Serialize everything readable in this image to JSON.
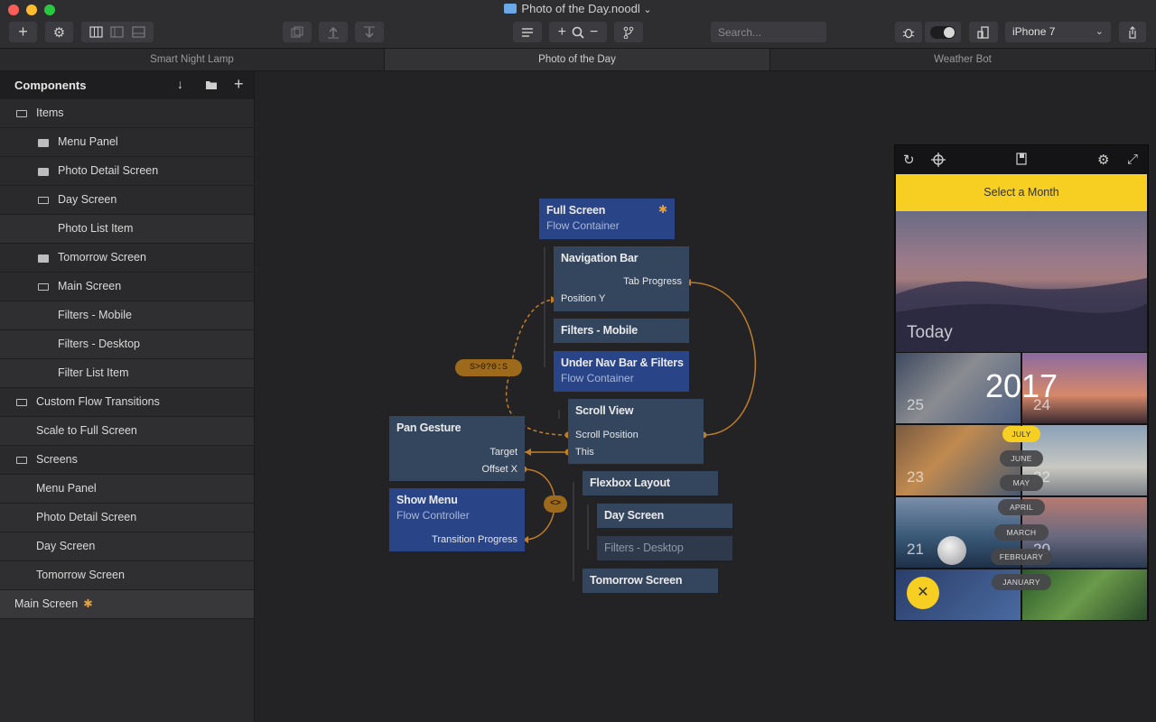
{
  "window": {
    "title": "Photo of the Day.noodl",
    "title_chevron": "⌄"
  },
  "toolbar": {
    "add_icon": "+",
    "settings_icon": "⚙",
    "search_placeholder": "Search...",
    "zoom_in": "+",
    "zoom_out": "−",
    "device": "iPhone 7",
    "device_chevron": "⌄"
  },
  "tabs": [
    {
      "label": "Smart Night Lamp"
    },
    {
      "label": "Photo of the Day"
    },
    {
      "label": "Weather Bot"
    }
  ],
  "sidebar": {
    "title": "Components",
    "items": [
      {
        "label": "Items"
      },
      {
        "label": "Menu Panel"
      },
      {
        "label": "Photo Detail Screen"
      },
      {
        "label": "Day Screen"
      },
      {
        "label": "Photo List Item"
      },
      {
        "label": "Tomorrow Screen"
      },
      {
        "label": "Main Screen"
      },
      {
        "label": "Filters - Mobile"
      },
      {
        "label": "Filters - Desktop"
      },
      {
        "label": "Filter List Item"
      },
      {
        "label": "Custom Flow Transitions"
      },
      {
        "label": "Scale to Full Screen"
      },
      {
        "label": "Screens"
      },
      {
        "label": "Menu Panel"
      },
      {
        "label": "Photo Detail Screen"
      },
      {
        "label": "Day Screen"
      },
      {
        "label": "Tomorrow Screen"
      },
      {
        "label": "Main Screen"
      }
    ],
    "selected_marker": "✱"
  },
  "nodes": {
    "full_screen": {
      "title": "Full Screen",
      "subtitle": "Flow Container",
      "marker": "✱"
    },
    "navigation_bar": {
      "title": "Navigation Bar",
      "port_tab_progress": "Tab Progress",
      "port_position_y": "Position Y"
    },
    "filters_mobile": {
      "title": "Filters - Mobile"
    },
    "under_nav": {
      "title": "Under Nav Bar & Filters",
      "subtitle": "Flow Container"
    },
    "scroll_view": {
      "title": "Scroll View",
      "port_scroll_position": "Scroll Position",
      "port_this": "This"
    },
    "pan_gesture": {
      "title": "Pan Gesture",
      "port_target": "Target",
      "port_offset_x": "Offset X"
    },
    "show_menu": {
      "title": "Show Menu",
      "subtitle": "Flow Controller",
      "port_transition_progress": "Transition Progress"
    },
    "flexbox_layout": {
      "title": "Flexbox Layout"
    },
    "day_screen": {
      "title": "Day Screen"
    },
    "filters_desktop": {
      "title": "Filters - Desktop"
    },
    "tomorrow_screen": {
      "title": "Tomorrow Screen"
    },
    "expression_label": "S>0?0:S",
    "switch_label": "<>"
  },
  "preview": {
    "header": "Select a Month",
    "hero_label": "Today",
    "year": "2017",
    "tile_numbers": [
      "25",
      "24",
      "23",
      "22",
      "21",
      "20"
    ],
    "months": [
      "JULY",
      "JUNE",
      "MAY",
      "APRIL",
      "MARCH",
      "FEBRUARY",
      "JANUARY"
    ],
    "active_month": "JULY",
    "fab_icon": "✕"
  },
  "colors": {
    "accent_yellow": "#f6cf22",
    "node_blue": "#2a4488",
    "node_slate": "#34455e",
    "wire_orange": "#c07d28"
  }
}
